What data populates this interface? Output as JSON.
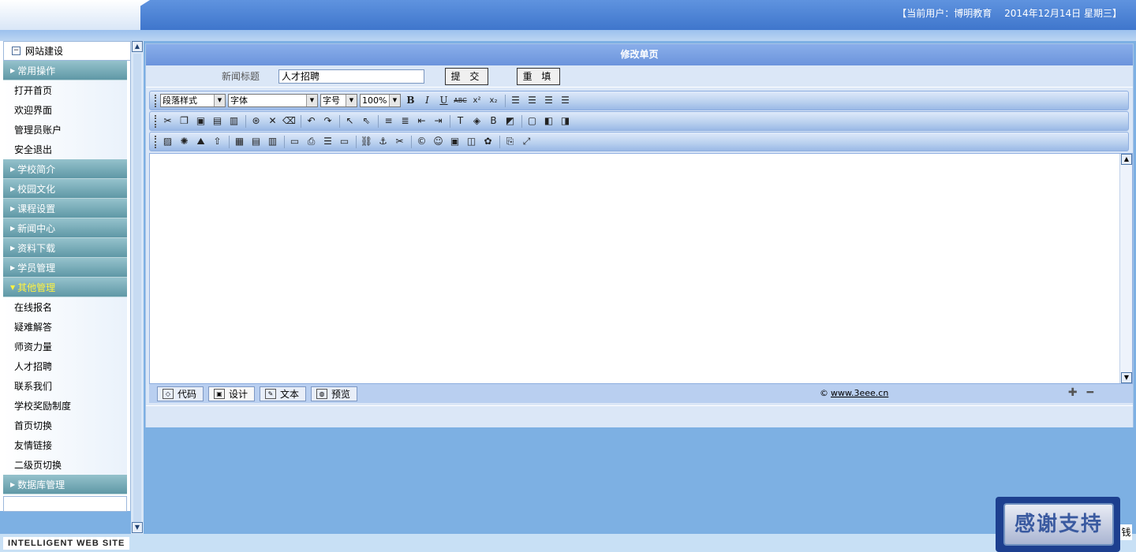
{
  "header": {
    "user_info": "【当前用户：博明教育　 2014年12月14日 星期三】"
  },
  "sidebar": {
    "root_label": "网站建设",
    "root_toggle": "−",
    "sections": [
      {
        "label": "常用操作",
        "open": false,
        "items": [
          "打开首页",
          "欢迎界面",
          "管理员账户",
          "安全退出"
        ]
      },
      {
        "label": "学校简介",
        "open": false,
        "items": []
      },
      {
        "label": "校园文化",
        "open": false,
        "items": []
      },
      {
        "label": "课程设置",
        "open": false,
        "items": []
      },
      {
        "label": "新闻中心",
        "open": false,
        "items": []
      },
      {
        "label": "资料下载",
        "open": false,
        "items": []
      },
      {
        "label": "学员管理",
        "open": false,
        "items": []
      },
      {
        "label": "其他管理",
        "open": true,
        "items": [
          "在线报名",
          "疑难解答",
          "师资力量",
          "人才招聘",
          "联系我们",
          "学校奖励制度",
          "首页切换",
          "友情链接",
          "二级页切换"
        ]
      },
      {
        "label": "数据库管理",
        "open": false,
        "items": []
      }
    ]
  },
  "footer": {
    "tag": "INTELLIGENT WEB SITE"
  },
  "main": {
    "title": "修改单页",
    "form": {
      "label": "新闻标题",
      "value": "人才招聘",
      "submit": "提 交",
      "reset": "重 填"
    },
    "toolbar": {
      "paragraph_style": "段落样式",
      "font": "字体",
      "font_size": "字号",
      "zoom": "100%"
    },
    "modes": [
      "代码",
      "设计",
      "文本",
      "预览"
    ],
    "active_mode": "设计",
    "credit_symbol": "©",
    "credit_link": "www.3eee.cn"
  },
  "badge": {
    "text": "感谢支持"
  },
  "corner_char": "钱"
}
